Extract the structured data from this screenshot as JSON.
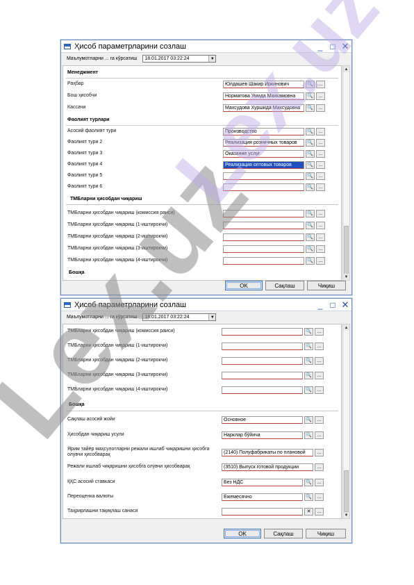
{
  "colors": {
    "titlebar_accent": "#1a4aa0",
    "selection": "#2050c0",
    "watermark_gray": "#8a8a8a",
    "watermark_violet": "#b8a6e6"
  },
  "icons": {
    "search": "search-icon",
    "ellipsis": "ellipsis-icon",
    "clear": "clear-icon",
    "minimize": "minimize-icon",
    "maximize": "maximize-icon",
    "close": "close-icon"
  },
  "watermark": {
    "text": "Lex.uz"
  },
  "window1": {
    "title": "Ҳисоб параметрларини созлаш",
    "toolbar_label": "Маълумотларни ... га кўрсатиш",
    "datetime": "18.01.2017 03:22:24",
    "sections": {
      "management": "Менеджмент",
      "activity": "Фаолият турлари",
      "tmb": "ТМБларни ҳисобдан чиқариш",
      "other": "Бошқа"
    },
    "rows": [
      {
        "label": "Раҳбар",
        "value": "Юлдашев Шакир Иркинович"
      },
      {
        "label": "Бош ҳисобчи",
        "value": "Норматова Умида Махкамовна"
      },
      {
        "label": "Кассачи",
        "value": "Махсудова Хуршида Махсудовна"
      },
      {
        "label": "Асосий фаолият тури",
        "value": "Производство"
      },
      {
        "label": "Фаолият тури 2",
        "value": "Реализация розничных товаров"
      },
      {
        "label": "Фаолият тури 3",
        "value": "Оказание услуг"
      },
      {
        "label": "Фаолият тури 4",
        "value": "Реализация оптовых товаров"
      },
      {
        "label": "Фаолият тури 5",
        "value": ""
      },
      {
        "label": "Фаолият тури 6",
        "value": ""
      },
      {
        "label": "ТМБларни ҳисобдан чиқариш (комиссия раиси)",
        "value": ""
      },
      {
        "label": "ТМБларни ҳисобдан чиқариш (1-иштирокчи)",
        "value": ""
      },
      {
        "label": "ТМБларни ҳисобдан чиқариш (2-иштирокчи)",
        "value": ""
      },
      {
        "label": "ТМБларни ҳисобдан чиқариш (3-иштирокчи)",
        "value": ""
      },
      {
        "label": "ТМБларни ҳисобдан чиқариш (4-иштирокчи)",
        "value": ""
      }
    ],
    "buttons": {
      "ok": "OK",
      "save": "Сақлаш",
      "exit": "Чиқиш"
    }
  },
  "window2": {
    "title": "Ҳисоб параметрларини созлаш",
    "toolbar_label": "Маълумотларни ... га кўрсатиш",
    "datetime": "18.01.2017 03:22:24",
    "sections": {
      "other": "Бошқа"
    },
    "rows": [
      {
        "label": "ТМБларни ҳисобдан чиқариш (комиссия раиси)",
        "value": ""
      },
      {
        "label": "ТМБларни ҳисобдан чиқариш (1-иштирокчи)",
        "value": ""
      },
      {
        "label": "ТМБларни ҳисобдан чиқариш (2-иштирокчи)",
        "value": ""
      },
      {
        "label": "ТМБларни ҳисобдан чиқариш (3-иштирокчи)",
        "value": ""
      },
      {
        "label": "ТМБларни ҳисобдан чиқариш (4-иштирокчи)",
        "value": ""
      },
      {
        "label": "Сақлаш асосий жойи",
        "value": "Основное"
      },
      {
        "label": "Ҳисобдан чиқариш усули",
        "value": "Нарклар бўйича"
      },
      {
        "label": "Ярим тайёр маҳсулотларни режали ишлаб чиқаришни ҳисобга олувчи ҳисобварақ",
        "value": "(2140) Полуфабрикаты по плановой"
      },
      {
        "label": "Режали ишлаб чиқаришни ҳисобга олувчи ҳисобварақ",
        "value": "(3510) Выпуск готовой продукции"
      },
      {
        "label": "ҚҚС асосий ставкаси",
        "value": "Без НДС"
      },
      {
        "label": "Переоценка валюты",
        "value": "Ежемесячно"
      },
      {
        "label": "Таҳрирлашни тақиқлаш санаси",
        "value": ""
      }
    ],
    "buttons": {
      "ok": "OK",
      "save": "Сақлаш",
      "exit": "Чиқиш"
    }
  }
}
